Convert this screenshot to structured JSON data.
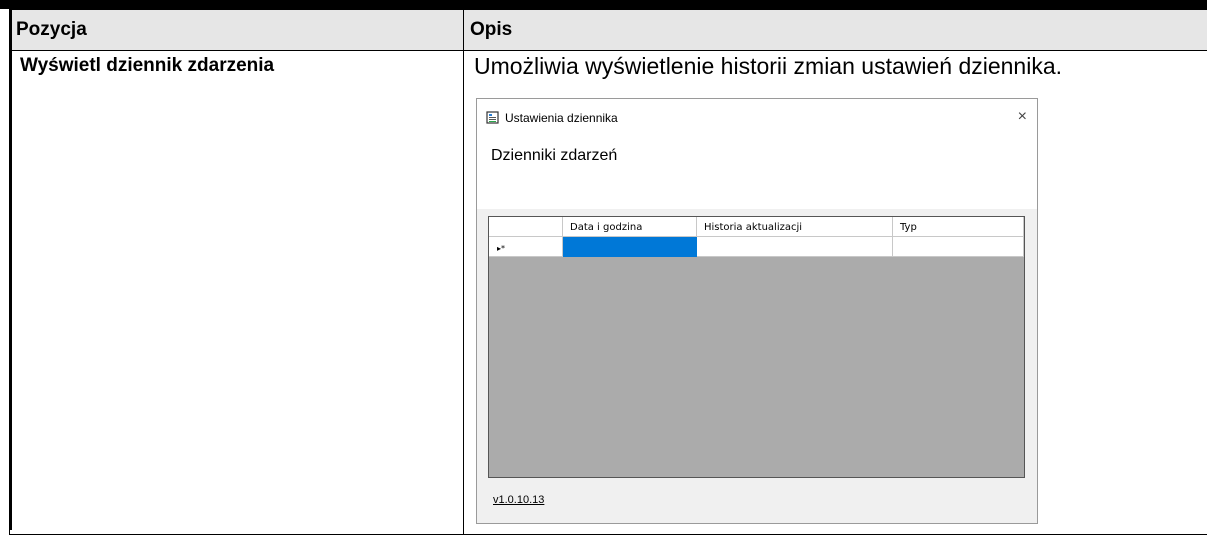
{
  "table": {
    "header_col1": "Pozycja",
    "header_col2": "Opis",
    "row1_name": "Wyświetl dziennik zdarzenia",
    "row1_description": "Umożliwia wyświetlenie historii zmian ustawień dziennika."
  },
  "dialog": {
    "title": "Ustawienia dziennika",
    "heading": "Dzienniki zdarzeń",
    "close_glyph": "×",
    "grid": {
      "columns": [
        "Data i godzina",
        "Historia aktualizacji",
        "Typ"
      ],
      "new_row_indicator": "▸*",
      "selection_color": "#0078d7"
    },
    "version": "v1.0.10.13"
  }
}
